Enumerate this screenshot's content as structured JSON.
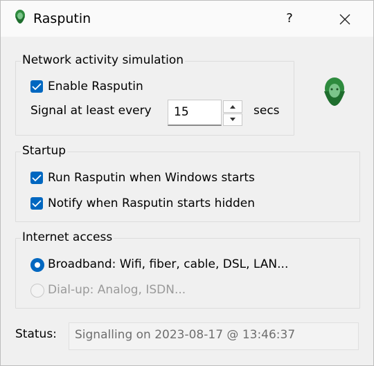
{
  "window": {
    "title": "Rasputin",
    "help_label": "?",
    "close_icon": "close-icon",
    "app_icon": "rasputin-portrait-icon"
  },
  "network": {
    "group_label": "Network activity simulation",
    "enable_label": "Enable Rasputin",
    "enable_checked": true,
    "signal_label": "Signal at least every",
    "signal_value": "15",
    "signal_unit": "secs"
  },
  "startup": {
    "group_label": "Startup",
    "run_label": "Run Rasputin when Windows starts",
    "run_checked": true,
    "notify_label": "Notify when Rasputin starts hidden",
    "notify_checked": true
  },
  "internet": {
    "group_label": "Internet access",
    "options": [
      {
        "label": "Broadband: Wifi, fiber, cable, DSL, LAN...",
        "selected": true,
        "enabled": true
      },
      {
        "label": "Dial-up: Analog, ISDN...",
        "selected": false,
        "enabled": false
      }
    ]
  },
  "status": {
    "label": "Status:",
    "value": "Signalling on 2023-08-17 @ 13:46:37"
  },
  "colors": {
    "accent": "#0067c0",
    "background": "#f0f0f0",
    "titlebar": "#fafafa",
    "icon_green": "#2e8b3e"
  }
}
